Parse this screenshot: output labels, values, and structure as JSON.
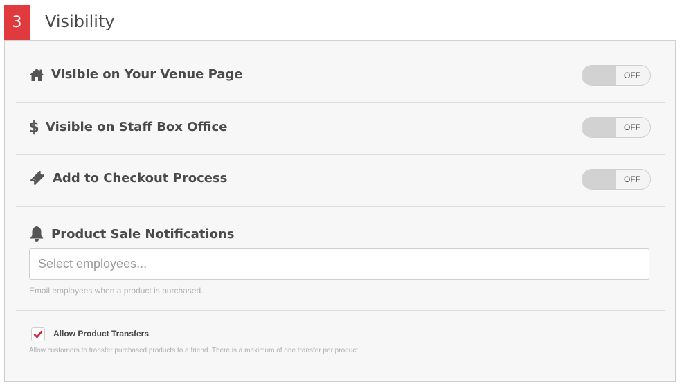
{
  "section": {
    "step_number": "3",
    "title": "Visibility"
  },
  "rows": [
    {
      "icon": "home-icon",
      "label": "Visible on Your Venue Page",
      "toggle_state": "OFF"
    },
    {
      "icon": "dollar-icon",
      "label": "Visible on Staff Box Office",
      "toggle_state": "OFF"
    },
    {
      "icon": "ticket-icon",
      "label": "Add to Checkout Process",
      "toggle_state": "OFF"
    }
  ],
  "notifications": {
    "icon": "bell-icon",
    "label": "Product Sale Notifications",
    "input_placeholder": "Select employees...",
    "input_value": "",
    "help_text": "Email employees when a product is purchased."
  },
  "transfers": {
    "checked": true,
    "label": "Allow Product Transfers",
    "help_text": "Allow customers to transfer purchased products to a friend. There is a maximum of one transfer per product."
  },
  "colors": {
    "accent": "#e03a3e",
    "panel_bg": "#f7f7f7",
    "text": "#4a4a4a"
  }
}
